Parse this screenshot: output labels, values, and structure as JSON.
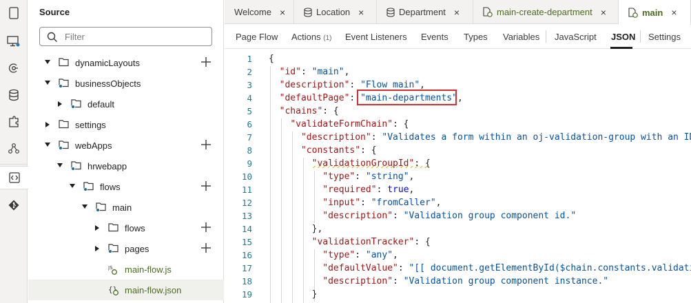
{
  "activity_bar": {
    "items": [
      {
        "icon": "device-icon"
      },
      {
        "icon": "web-app-icon"
      },
      {
        "icon": "services-icon"
      },
      {
        "icon": "business-objects-icon"
      },
      {
        "icon": "components-icon"
      },
      {
        "icon": "processes-icon"
      },
      {
        "icon": "source-icon",
        "active": true
      },
      {
        "icon": "git-icon"
      }
    ]
  },
  "sidebar": {
    "title": "Source",
    "filter_placeholder": "Filter",
    "tree": [
      {
        "label": "dynamicLayouts",
        "depth": 0,
        "expanded": true,
        "type": "folder",
        "plus": true
      },
      {
        "label": "businessObjects",
        "depth": 0,
        "expanded": true,
        "type": "folder-dot",
        "plus": false
      },
      {
        "label": "default",
        "depth": 1,
        "expanded": false,
        "type": "folder-dot",
        "plus": false
      },
      {
        "label": "settings",
        "depth": 0,
        "expanded": false,
        "type": "folder",
        "plus": false
      },
      {
        "label": "webApps",
        "depth": 0,
        "expanded": true,
        "type": "folder-dot",
        "plus": true
      },
      {
        "label": "hrwebapp",
        "depth": 1,
        "expanded": true,
        "type": "folder-dot",
        "plus": false
      },
      {
        "label": "flows",
        "depth": 2,
        "expanded": true,
        "type": "folder-dot",
        "plus": true
      },
      {
        "label": "main",
        "depth": 3,
        "expanded": true,
        "type": "folder-dot",
        "plus": false
      },
      {
        "label": "flows",
        "depth": 4,
        "expanded": false,
        "type": "folder",
        "plus": true
      },
      {
        "label": "pages",
        "depth": 4,
        "expanded": false,
        "type": "folder-dot",
        "plus": true
      },
      {
        "label": "main-flow.js",
        "depth": 4,
        "type": "js-file",
        "plus": false
      },
      {
        "label": "main-flow.json",
        "depth": 4,
        "type": "json-file",
        "plus": false,
        "selected": true
      }
    ]
  },
  "tabs": [
    {
      "label": "Welcome",
      "icon": ""
    },
    {
      "label": "Location",
      "icon": "database-icon"
    },
    {
      "label": "Department",
      "icon": "database-icon"
    },
    {
      "label": "main-create-department",
      "icon": "flow-file-icon"
    },
    {
      "label": "main",
      "icon": "flow-file-icon",
      "active": true
    }
  ],
  "close_glyph": "×",
  "subtabs": [
    {
      "label": "Page Flow"
    },
    {
      "label": "Actions",
      "count": "(1)"
    },
    {
      "label": "Event Listeners"
    },
    {
      "label": "Events"
    },
    {
      "label": "Types"
    },
    {
      "label": "Variables"
    },
    {
      "label": "JavaScript"
    },
    {
      "label": "JSON",
      "active": true
    },
    {
      "label": "Settings"
    }
  ],
  "editor": {
    "line_numbers": [
      "1",
      "2",
      "3",
      "4",
      "5",
      "6",
      "7",
      "8",
      "9",
      "10",
      "11",
      "12",
      "13",
      "14",
      "15",
      "16",
      "17",
      "18",
      "19"
    ],
    "lines": [
      [
        {
          "t": "{",
          "c": "n"
        }
      ],
      [
        {
          "t": "  ",
          "c": "n"
        },
        {
          "t": "\"id\"",
          "c": "k"
        },
        {
          "t": ": ",
          "c": "n"
        },
        {
          "t": "\"main\"",
          "c": "s"
        },
        {
          "t": ",",
          "c": "n"
        }
      ],
      [
        {
          "t": "  ",
          "c": "n"
        },
        {
          "t": "\"description\"",
          "c": "k"
        },
        {
          "t": ": ",
          "c": "n"
        },
        {
          "t": "\"Flow main\"",
          "c": "s"
        },
        {
          "t": ",",
          "c": "n"
        }
      ],
      [
        {
          "t": "  ",
          "c": "n"
        },
        {
          "t": "\"defaultPage\"",
          "c": "k"
        },
        {
          "t": ": ",
          "c": "n"
        },
        {
          "t": "\"main-departments\"",
          "c": "s"
        },
        {
          "t": ",",
          "c": "n"
        }
      ],
      [
        {
          "t": "  ",
          "c": "n"
        },
        {
          "t": "\"chains\"",
          "c": "k"
        },
        {
          "t": ": {",
          "c": "n"
        }
      ],
      [
        {
          "t": "    ",
          "c": "n"
        },
        {
          "t": "\"validateFormChain\"",
          "c": "k"
        },
        {
          "t": ": {",
          "c": "n"
        }
      ],
      [
        {
          "t": "      ",
          "c": "n"
        },
        {
          "t": "\"description\"",
          "c": "k"
        },
        {
          "t": ": ",
          "c": "n"
        },
        {
          "t": "\"Validates a form within an oj-validation-group with an ID",
          "c": "s"
        }
      ],
      [
        {
          "t": "      ",
          "c": "n"
        },
        {
          "t": "\"constants\"",
          "c": "k"
        },
        {
          "t": ": {",
          "c": "n"
        }
      ],
      [
        {
          "t": "        ",
          "c": "n"
        },
        {
          "t": "\"validationGroupId\"",
          "c": "k"
        },
        {
          "t": ": {",
          "c": "n"
        }
      ],
      [
        {
          "t": "          ",
          "c": "n"
        },
        {
          "t": "\"type\"",
          "c": "k"
        },
        {
          "t": ": ",
          "c": "n"
        },
        {
          "t": "\"string\"",
          "c": "s"
        },
        {
          "t": ",",
          "c": "n"
        }
      ],
      [
        {
          "t": "          ",
          "c": "n"
        },
        {
          "t": "\"required\"",
          "c": "k"
        },
        {
          "t": ": ",
          "c": "n"
        },
        {
          "t": "true",
          "c": "b"
        },
        {
          "t": ",",
          "c": "n"
        }
      ],
      [
        {
          "t": "          ",
          "c": "n"
        },
        {
          "t": "\"input\"",
          "c": "k"
        },
        {
          "t": ": ",
          "c": "n"
        },
        {
          "t": "\"fromCaller\"",
          "c": "s"
        },
        {
          "t": ",",
          "c": "n"
        }
      ],
      [
        {
          "t": "          ",
          "c": "n"
        },
        {
          "t": "\"description\"",
          "c": "k"
        },
        {
          "t": ": ",
          "c": "n"
        },
        {
          "t": "\"Validation group component id.\"",
          "c": "s"
        }
      ],
      [
        {
          "t": "        ",
          "c": "n"
        },
        {
          "t": "},",
          "c": "n"
        }
      ],
      [
        {
          "t": "        ",
          "c": "n"
        },
        {
          "t": "\"validationTracker\"",
          "c": "k"
        },
        {
          "t": ": {",
          "c": "n"
        }
      ],
      [
        {
          "t": "          ",
          "c": "n"
        },
        {
          "t": "\"type\"",
          "c": "k"
        },
        {
          "t": ": ",
          "c": "n"
        },
        {
          "t": "\"any\"",
          "c": "s"
        },
        {
          "t": ",",
          "c": "n"
        }
      ],
      [
        {
          "t": "          ",
          "c": "n"
        },
        {
          "t": "\"defaultValue\"",
          "c": "k"
        },
        {
          "t": ": ",
          "c": "n"
        },
        {
          "t": "\"[[ document.getElementById($chain.constants.validatio",
          "c": "s"
        }
      ],
      [
        {
          "t": "          ",
          "c": "n"
        },
        {
          "t": "\"description\"",
          "c": "k"
        },
        {
          "t": ": ",
          "c": "n"
        },
        {
          "t": "\"Validation group component instance.\"",
          "c": "s"
        }
      ],
      [
        {
          "t": "        ",
          "c": "n"
        },
        {
          "t": "}",
          "c": "n"
        }
      ]
    ]
  },
  "colors": {
    "accent_green": "#4b6b21",
    "json_key": "#a31515",
    "json_string": "#0451a5",
    "line_number": "#237893",
    "highlight_border": "#d32f2f"
  }
}
